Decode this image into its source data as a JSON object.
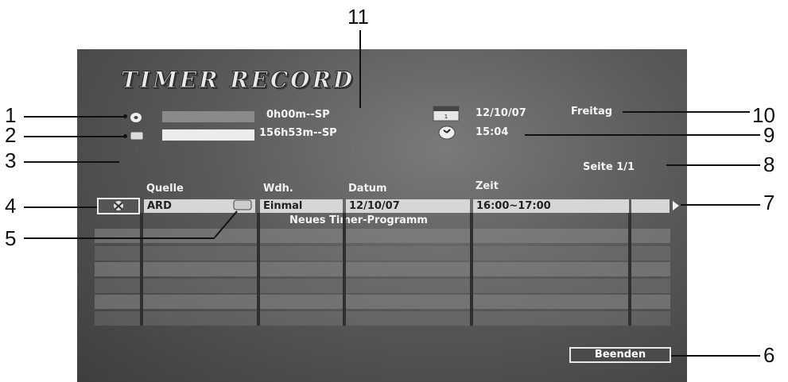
{
  "title": "TIMER RECORD",
  "disc": {
    "icon": "disc-icon",
    "time": "0h00m--SP"
  },
  "hdd": {
    "icon": "hdd-icon",
    "time": "156h53m--SP"
  },
  "date": {
    "icon": "calendar-icon",
    "calendar_label": "JAN 1",
    "value": "12/10/07",
    "weekday": "Freitag"
  },
  "clock": {
    "icon": "clock-icon",
    "value": "15:04"
  },
  "page": "Seite  1/1",
  "table": {
    "headers": {
      "source": "Quelle",
      "repeat": "Wdh.",
      "date": "Datum",
      "time": "Zeit"
    },
    "row1": {
      "source": "ARD",
      "repeat": "Einmal",
      "date": "12/10/07",
      "time": "16:00~17:00"
    },
    "new_program": "Neues  Timer-Programm"
  },
  "exit_button": "Beenden",
  "callouts": [
    "1",
    "2",
    "3",
    "4",
    "5",
    "6",
    "7",
    "8",
    "9",
    "10",
    "11"
  ]
}
